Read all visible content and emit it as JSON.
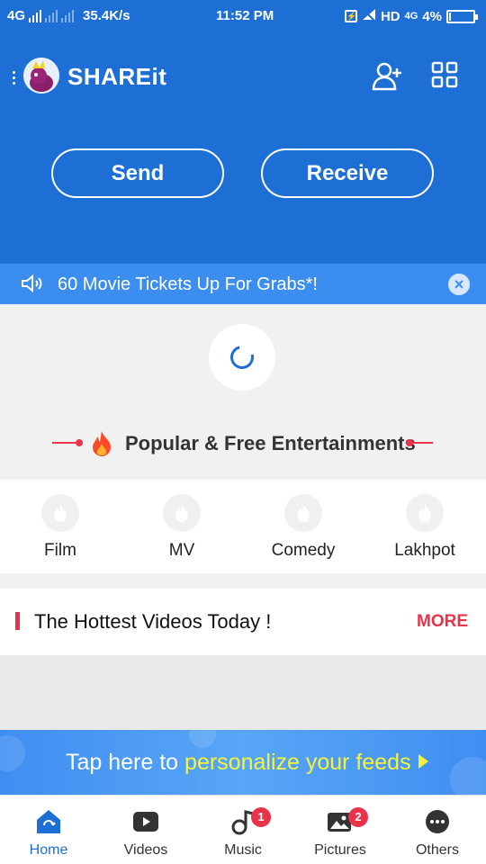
{
  "status_bar": {
    "network_type": "4G",
    "speed": "35.4K/s",
    "time": "11:52 PM",
    "hd_label": "HD",
    "network_4g": "4G",
    "battery_percent_text": "4%",
    "battery_level": 0.04
  },
  "header": {
    "app_title": "SHAREit",
    "send_label": "Send",
    "receive_label": "Receive"
  },
  "notice": {
    "text": "60 Movie Tickets Up For Grabs*!"
  },
  "section": {
    "popular_title": "Popular & Free Entertainments"
  },
  "categories": [
    {
      "label": "Film"
    },
    {
      "label": "MV"
    },
    {
      "label": "Comedy"
    },
    {
      "label": "Lakhpot"
    }
  ],
  "hottest": {
    "title": "The Hottest Videos Today !",
    "more_label": "MORE"
  },
  "personalize": {
    "text_prefix": "Tap here to",
    "text_highlight": "personalize your feeds"
  },
  "bottom_nav": {
    "items": [
      {
        "label": "Home",
        "icon": "home-icon",
        "active": true
      },
      {
        "label": "Videos",
        "icon": "videos-icon"
      },
      {
        "label": "Music",
        "icon": "music-icon",
        "badge": "1"
      },
      {
        "label": "Pictures",
        "icon": "pictures-icon",
        "badge": "2"
      },
      {
        "label": "Others",
        "icon": "others-icon"
      }
    ]
  },
  "colors": {
    "primary_blue": "#1d6fd6",
    "notice_blue": "#3b8ef0",
    "accent_red": "#e8334a",
    "highlight_yellow": "#f7f23a"
  }
}
